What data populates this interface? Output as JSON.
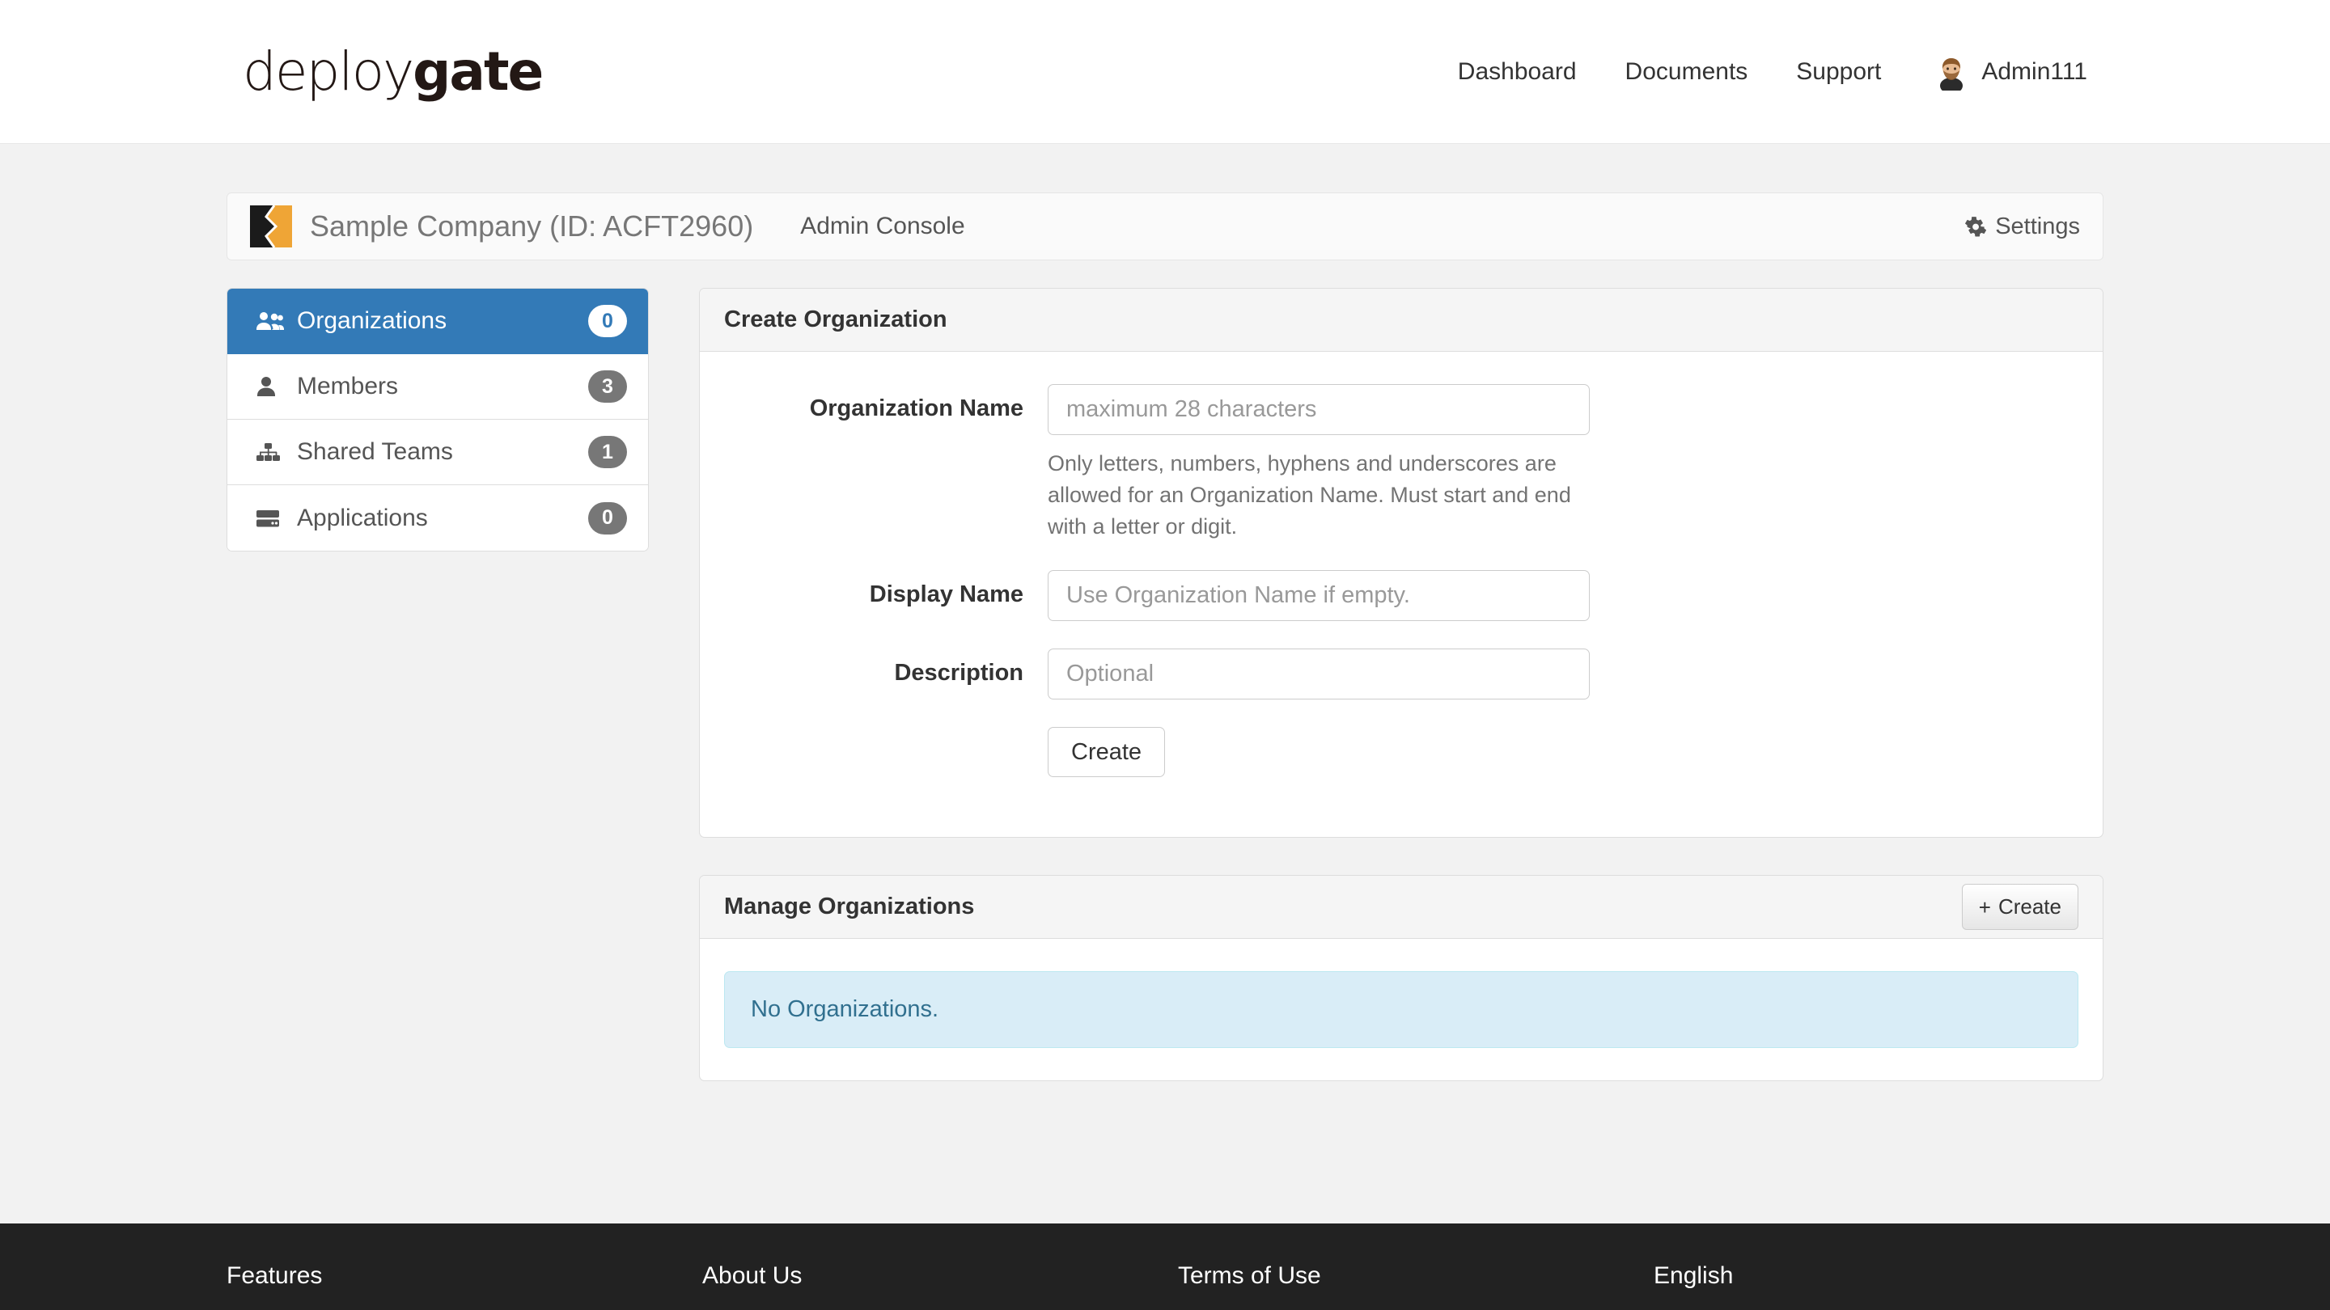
{
  "navbar": {
    "brand": {
      "light": "deploy",
      "bold": "gate"
    },
    "links": [
      {
        "label": "Dashboard"
      },
      {
        "label": "Documents"
      },
      {
        "label": "Support"
      }
    ],
    "user": {
      "name": "Admin111",
      "avatar_icon": "user-avatar-icon"
    }
  },
  "org_bar": {
    "icon": "company-logo-icon",
    "title": "Sample Company (ID: ACFT2960)",
    "subtitle": "Admin Console",
    "settings": {
      "label": "Settings",
      "icon": "gear-icon"
    }
  },
  "sidebar": {
    "items": [
      {
        "label": "Organizations",
        "count": "0",
        "icon": "users-icon",
        "active": true
      },
      {
        "label": "Members",
        "count": "3",
        "icon": "user-icon",
        "active": false
      },
      {
        "label": "Shared Teams",
        "count": "1",
        "icon": "sitemap-icon",
        "active": false
      },
      {
        "label": "Applications",
        "count": "0",
        "icon": "server-icon",
        "active": false
      }
    ]
  },
  "create_panel": {
    "title": "Create Organization",
    "fields": {
      "org_name": {
        "label": "Organization Name",
        "value": "",
        "placeholder": "maximum 28 characters",
        "help": "Only letters, numbers, hyphens and underscores are allowed for an Organization Name. Must start and end with a letter or digit."
      },
      "display_name": {
        "label": "Display Name",
        "value": "",
        "placeholder": "Use Organization Name if empty."
      },
      "description": {
        "label": "Description",
        "value": "",
        "placeholder": "Optional"
      }
    },
    "submit_label": "Create"
  },
  "manage_panel": {
    "title": "Manage Organizations",
    "create_label": "Create",
    "create_icon": "plus-icon",
    "empty_message": "No Organizations."
  },
  "footer": {
    "links": [
      {
        "label": "Features"
      },
      {
        "label": "About Us"
      },
      {
        "label": "Terms of Use"
      },
      {
        "label": "English"
      }
    ]
  },
  "colors": {
    "primary": "#337ab7",
    "brand_dark": "#231815",
    "brand_amber": "#efa536",
    "info_bg": "#d9edf7",
    "info_text": "#31708f",
    "footer_bg": "#222222"
  }
}
